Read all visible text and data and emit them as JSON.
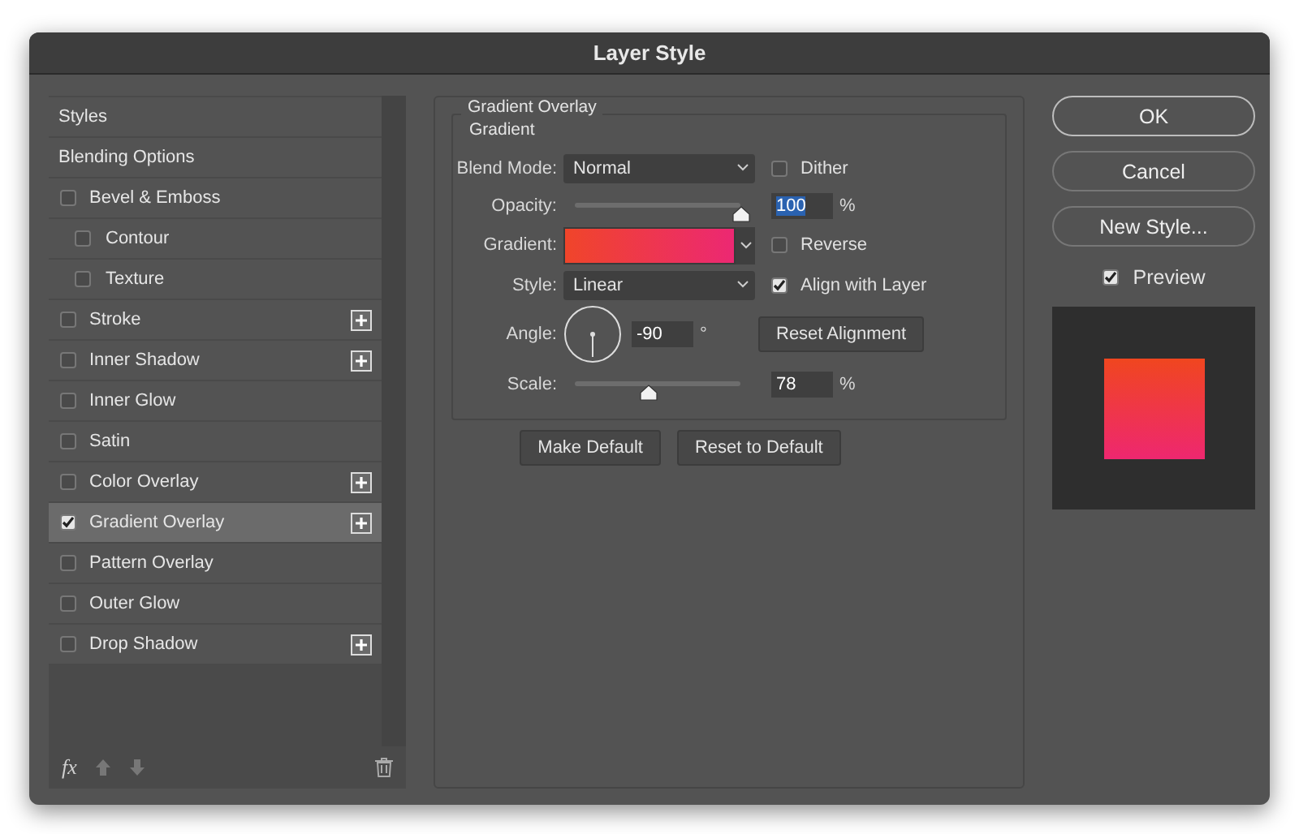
{
  "window": {
    "title": "Layer Style"
  },
  "styles": {
    "items": [
      {
        "kind": "header",
        "label": "Styles",
        "selected": false
      },
      {
        "kind": "header",
        "label": "Blending Options",
        "selected": false
      },
      {
        "kind": "check",
        "label": "Bevel & Emboss",
        "checked": false,
        "selected": false,
        "addable": false,
        "children": [
          {
            "kind": "check",
            "label": "Contour",
            "checked": false,
            "selected": false,
            "addable": false
          },
          {
            "kind": "check",
            "label": "Texture",
            "checked": false,
            "selected": false,
            "addable": false
          }
        ]
      },
      {
        "kind": "check",
        "label": "Stroke",
        "checked": false,
        "selected": false,
        "addable": true
      },
      {
        "kind": "check",
        "label": "Inner Shadow",
        "checked": false,
        "selected": false,
        "addable": true
      },
      {
        "kind": "check",
        "label": "Inner Glow",
        "checked": false,
        "selected": false,
        "addable": false
      },
      {
        "kind": "check",
        "label": "Satin",
        "checked": false,
        "selected": false,
        "addable": false
      },
      {
        "kind": "check",
        "label": "Color Overlay",
        "checked": false,
        "selected": false,
        "addable": true
      },
      {
        "kind": "check",
        "label": "Gradient Overlay",
        "checked": true,
        "selected": true,
        "addable": true
      },
      {
        "kind": "check",
        "label": "Pattern Overlay",
        "checked": false,
        "selected": false,
        "addable": false
      },
      {
        "kind": "check",
        "label": "Outer Glow",
        "checked": false,
        "selected": false,
        "addable": false
      },
      {
        "kind": "check",
        "label": "Drop Shadow",
        "checked": false,
        "selected": false,
        "addable": true
      }
    ],
    "fx_label": "fx"
  },
  "panel": {
    "title": "Gradient Overlay",
    "group": "Gradient",
    "blend_mode": {
      "label": "Blend Mode:",
      "value": "Normal"
    },
    "dither": {
      "label": "Dither",
      "checked": false
    },
    "opacity": {
      "label": "Opacity:",
      "level": 1,
      "value": "100",
      "unit": "%"
    },
    "gradient": {
      "label": "Gradient:"
    },
    "reverse": {
      "label": "Reverse",
      "checked": false
    },
    "style": {
      "label": "Style:",
      "value": "Linear"
    },
    "align": {
      "label": "Align with Layer",
      "checked": true
    },
    "angle": {
      "label": "Angle:",
      "value": "-90",
      "unit": "°"
    },
    "reset_alignment": "Reset Alignment",
    "scale": {
      "label": "Scale:",
      "level": 0.44,
      "value": "78",
      "unit": "%"
    },
    "buttons": [
      "Make Default",
      "Reset to Default"
    ]
  },
  "actions": {
    "buttons": [
      "OK",
      "Cancel",
      "New Style..."
    ],
    "preview": {
      "label": "Preview",
      "checked": true
    }
  }
}
